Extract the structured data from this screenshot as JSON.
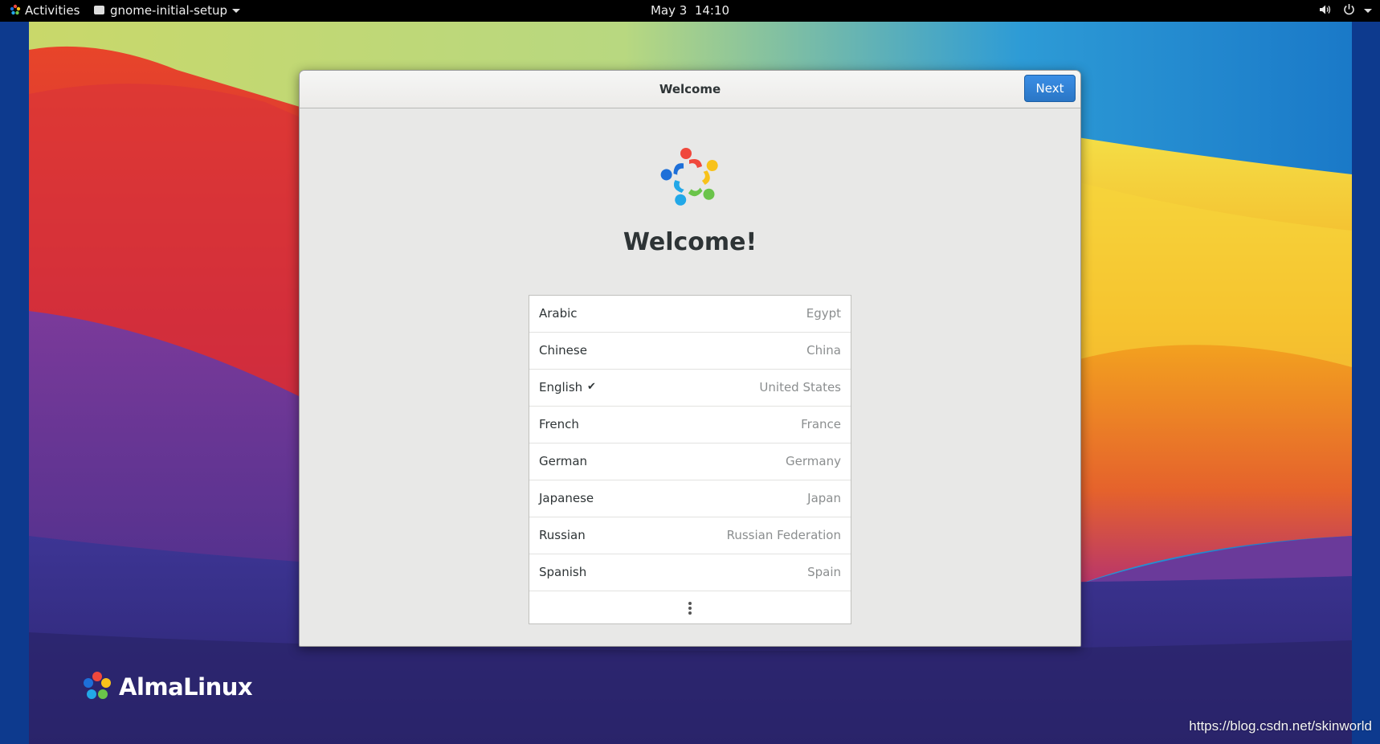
{
  "topbar": {
    "activities_label": "Activities",
    "app_menu_label": "gnome-initial-setup",
    "clock_date": "May 3",
    "clock_time": "14:10"
  },
  "desktop": {
    "brand_text": "AlmaLinux",
    "watermark": "https://blog.csdn.net/skinworld"
  },
  "dialog": {
    "title": "Welcome",
    "next_label": "Next",
    "heading": "Welcome!",
    "languages": [
      {
        "name": "Arabic",
        "region": "Egypt",
        "selected": false
      },
      {
        "name": "Chinese",
        "region": "China",
        "selected": false
      },
      {
        "name": "English",
        "region": "United States",
        "selected": true
      },
      {
        "name": "French",
        "region": "France",
        "selected": false
      },
      {
        "name": "German",
        "region": "Germany",
        "selected": false
      },
      {
        "name": "Japanese",
        "region": "Japan",
        "selected": false
      },
      {
        "name": "Russian",
        "region": "Russian Federation",
        "selected": false
      },
      {
        "name": "Spanish",
        "region": "Spain",
        "selected": false
      }
    ],
    "selected_mark": "✔"
  },
  "icons": {
    "topbar_logo": "almalinux-logo-icon",
    "app_menu": "app-window-icon",
    "volume": "volume-icon",
    "power": "power-icon",
    "more": "more-vertical-icon"
  },
  "colors": {
    "accent": "#2f7fd4",
    "topbar_bg": "#000000",
    "dialog_bg": "#e8e8e7"
  }
}
